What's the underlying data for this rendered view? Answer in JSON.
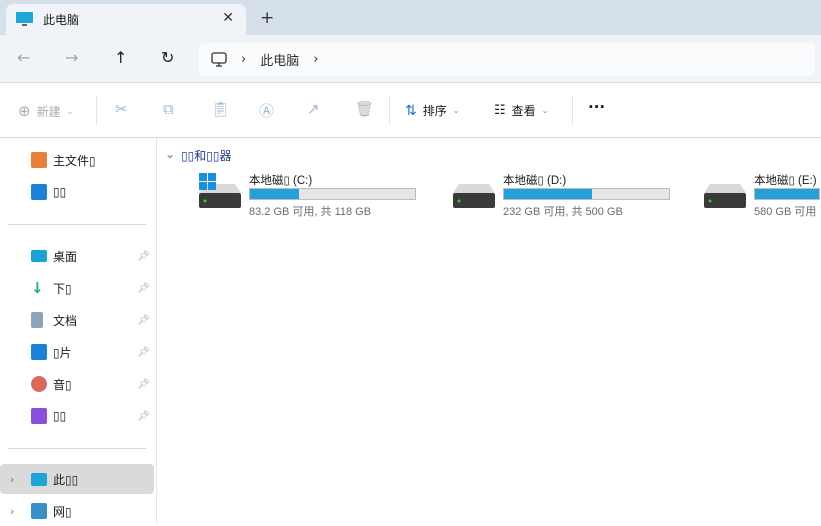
{
  "tab": {
    "title": "此电脑",
    "close": "✕",
    "new_tab": "+"
  },
  "nav": {
    "back": "←",
    "forward": "→",
    "up": "↑",
    "refresh": "↻"
  },
  "address": {
    "crumbs": [
      "此电脑"
    ],
    "sep": "›"
  },
  "toolbar": {
    "new_label": "新建",
    "sort_label": "排序",
    "view_label": "查看",
    "more": "···"
  },
  "sidebar": {
    "quick": [
      {
        "label": "主文件▯"
      },
      {
        "label": "▯▯"
      }
    ],
    "pinned": [
      {
        "label": "桌面"
      },
      {
        "label": "下▯"
      },
      {
        "label": "文档"
      },
      {
        "label": "▯片"
      },
      {
        "label": "音▯"
      },
      {
        "label": "▯▯"
      }
    ],
    "tree": [
      {
        "label": "此▯▯",
        "selected": true
      },
      {
        "label": "网▯"
      }
    ]
  },
  "group_title": "▯▯和▯▯器",
  "drives": [
    {
      "name": "本地磁▯ (C:)",
      "info": "83.2 GB 可用, 共 118 GB",
      "used_percent": 29.5
    },
    {
      "name": "本地磁▯ (D:)",
      "info": "232 GB 可用, 共 500 GB",
      "used_percent": 53.6
    },
    {
      "name": "本地磁▯ (E:)",
      "info": "580 GB 可用",
      "used_percent": null
    }
  ],
  "colors": {
    "accent": "#26a0da",
    "selected_bg": "#dadada"
  }
}
